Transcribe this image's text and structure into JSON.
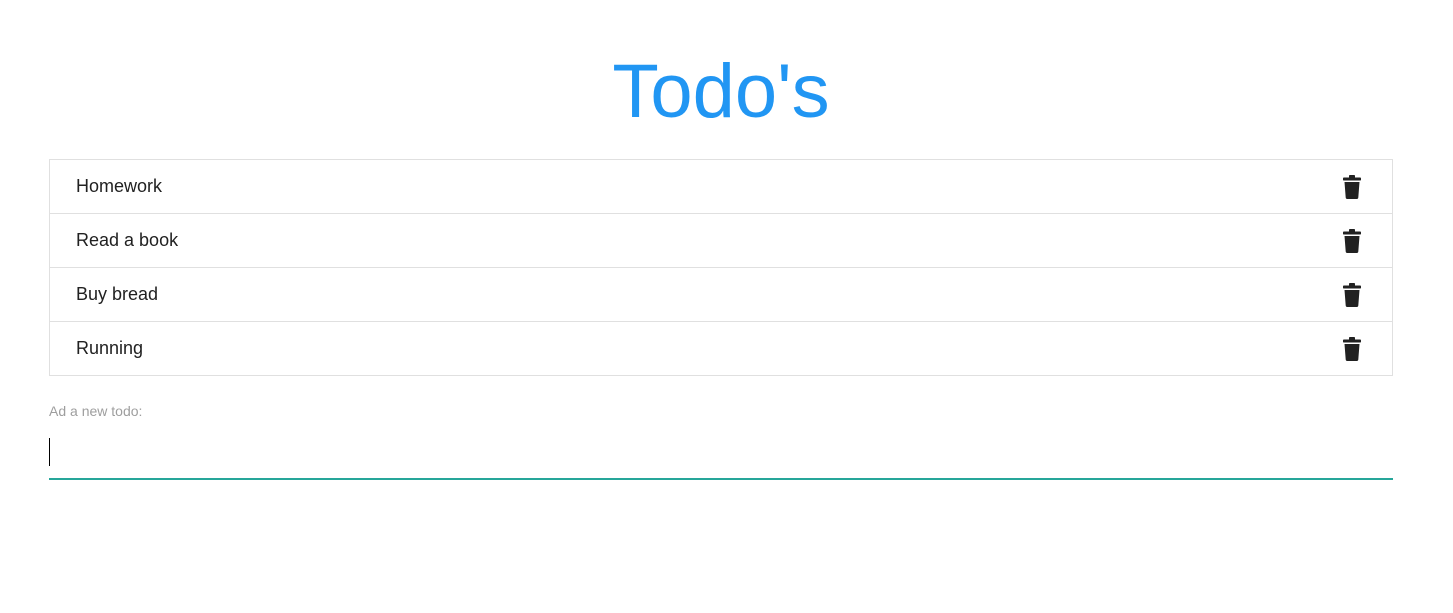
{
  "header": {
    "title": "Todo's"
  },
  "todos": [
    {
      "text": "Homework"
    },
    {
      "text": "Read a book"
    },
    {
      "text": "Buy bread"
    },
    {
      "text": "Running"
    }
  ],
  "new_todo": {
    "label": "Ad a new todo:",
    "value": "",
    "placeholder": ""
  },
  "icons": {
    "delete": "trash-icon"
  },
  "colors": {
    "title": "#2196f3",
    "input_underline": "#26a69a",
    "border": "#e0e0e0",
    "label": "#9e9e9e",
    "text": "#212121",
    "icon": "#212121"
  }
}
